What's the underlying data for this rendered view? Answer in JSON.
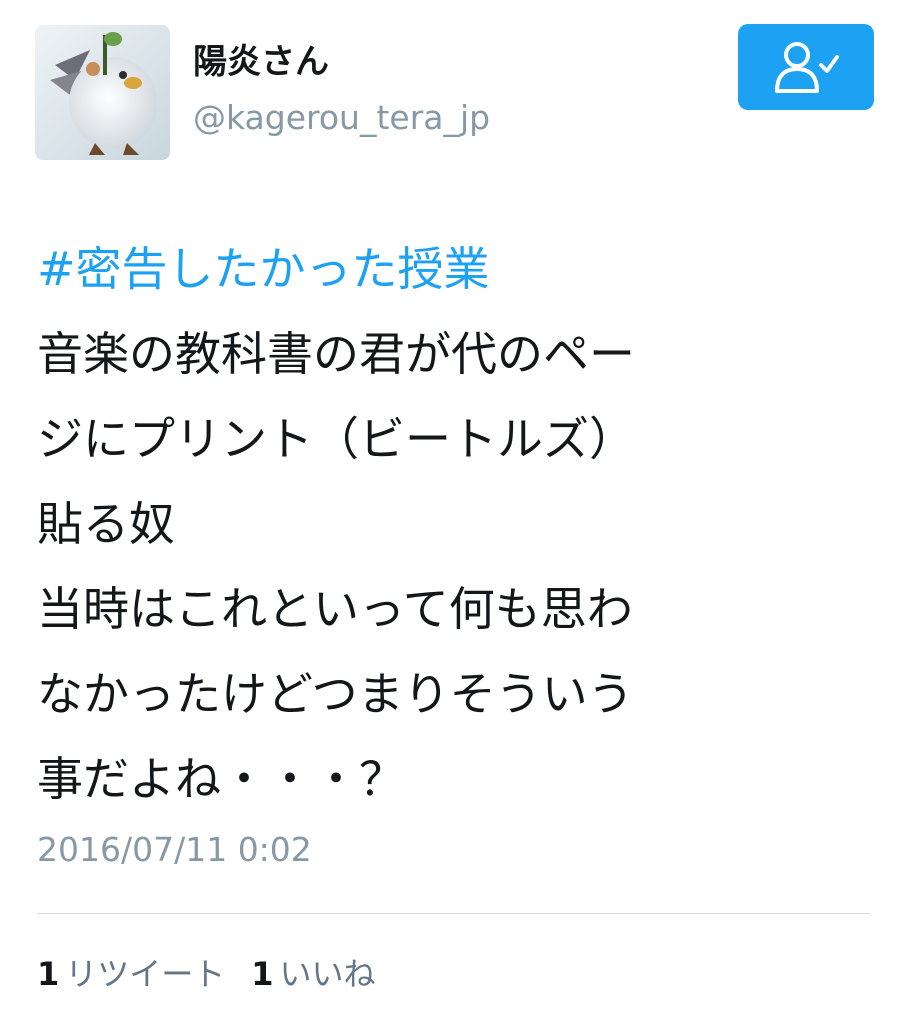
{
  "user": {
    "display_name": "陽炎さん",
    "handle": "@kagerou_tera_jp",
    "avatar_icon": "chocobo-fat-avatar"
  },
  "follow_button": {
    "icon": "following-user-check-icon",
    "color": "#1da1f2"
  },
  "tweet": {
    "hashtag": "#密告したかった授業",
    "lines": [
      "音楽の教科書の君が代のペー",
      "ジにプリント（ビートルズ）",
      "貼る奴",
      "当時はこれといって何も思わ",
      "なかったけどつまりそういう",
      "事だよね・・・？"
    ],
    "timestamp": "2016/07/11 0:02"
  },
  "stats": {
    "retweet_count": "1",
    "retweet_label": "リツイート",
    "like_count": "1",
    "like_label": "いいね"
  },
  "colors": {
    "accent": "#1da1f2",
    "muted_text": "#8899a6",
    "text": "#14171a"
  }
}
